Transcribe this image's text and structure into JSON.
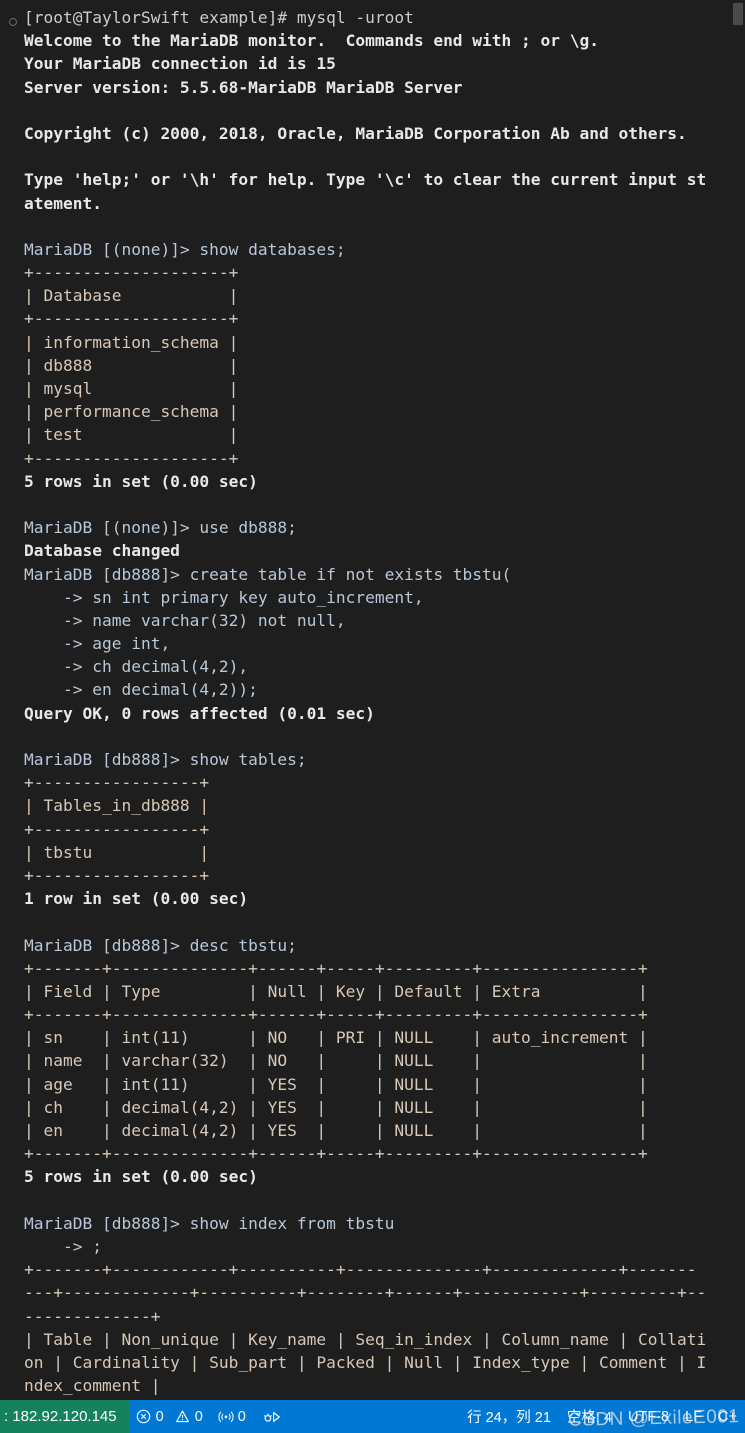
{
  "terminal": {
    "lines": [
      {
        "text": "[root@TaylorSwift example]# mysql -uroot",
        "style": "default",
        "marker": true
      },
      {
        "text": "Welcome to the MariaDB monitor.  Commands end with ; or \\g.",
        "style": "bold"
      },
      {
        "text": "Your MariaDB connection id is 15",
        "style": "bold"
      },
      {
        "text": "Server version: 5.5.68-MariaDB MariaDB Server",
        "style": "bold"
      },
      {
        "text": "",
        "style": "default"
      },
      {
        "text": "Copyright (c) 2000, 2018, Oracle, MariaDB Corporation Ab and others.",
        "style": "bold"
      },
      {
        "text": "",
        "style": "default"
      },
      {
        "text": "Type 'help;' or '\\h' for help. Type '\\c' to clear the current input st",
        "style": "bold"
      },
      {
        "text": "atement.",
        "style": "bold"
      },
      {
        "text": "",
        "style": "default"
      },
      {
        "text": "MariaDB [(none)]> show databases;",
        "style": "prompt"
      },
      {
        "text": "+--------------------+",
        "style": "table"
      },
      {
        "text": "| Database           |",
        "style": "table"
      },
      {
        "text": "+--------------------+",
        "style": "table"
      },
      {
        "text": "| information_schema |",
        "style": "table"
      },
      {
        "text": "| db888              |",
        "style": "table"
      },
      {
        "text": "| mysql              |",
        "style": "table"
      },
      {
        "text": "| performance_schema |",
        "style": "table"
      },
      {
        "text": "| test               |",
        "style": "table"
      },
      {
        "text": "+--------------------+",
        "style": "table"
      },
      {
        "text": "5 rows in set (0.00 sec)",
        "style": "bold"
      },
      {
        "text": "",
        "style": "default"
      },
      {
        "text": "MariaDB [(none)]> use db888;",
        "style": "prompt"
      },
      {
        "text": "Database changed",
        "style": "bold"
      },
      {
        "text": "MariaDB [db888]> create table if not exists tbstu(",
        "style": "prompt"
      },
      {
        "text": "    -> sn int primary key auto_increment,",
        "style": "prompt"
      },
      {
        "text": "    -> name varchar(32) not null,",
        "style": "prompt"
      },
      {
        "text": "    -> age int,",
        "style": "prompt"
      },
      {
        "text": "    -> ch decimal(4,2),",
        "style": "prompt"
      },
      {
        "text": "    -> en decimal(4,2));",
        "style": "prompt"
      },
      {
        "text": "Query OK, 0 rows affected (0.01 sec)",
        "style": "bold"
      },
      {
        "text": "",
        "style": "default"
      },
      {
        "text": "MariaDB [db888]> show tables;",
        "style": "prompt"
      },
      {
        "text": "+-----------------+",
        "style": "table"
      },
      {
        "text": "| Tables_in_db888 |",
        "style": "table"
      },
      {
        "text": "+-----------------+",
        "style": "table"
      },
      {
        "text": "| tbstu           |",
        "style": "table"
      },
      {
        "text": "+-----------------+",
        "style": "table"
      },
      {
        "text": "1 row in set (0.00 sec)",
        "style": "bold"
      },
      {
        "text": "",
        "style": "default"
      },
      {
        "text": "MariaDB [db888]> desc tbstu;",
        "style": "prompt"
      },
      {
        "text": "+-------+--------------+------+-----+---------+----------------+",
        "style": "table"
      },
      {
        "text": "| Field | Type         | Null | Key | Default | Extra          |",
        "style": "table"
      },
      {
        "text": "+-------+--------------+------+-----+---------+----------------+",
        "style": "table"
      },
      {
        "text": "| sn    | int(11)      | NO   | PRI | NULL    | auto_increment |",
        "style": "table"
      },
      {
        "text": "| name  | varchar(32)  | NO   |     | NULL    |                |",
        "style": "table"
      },
      {
        "text": "| age   | int(11)      | YES  |     | NULL    |                |",
        "style": "table"
      },
      {
        "text": "| ch    | decimal(4,2) | YES  |     | NULL    |                |",
        "style": "table"
      },
      {
        "text": "| en    | decimal(4,2) | YES  |     | NULL    |                |",
        "style": "table"
      },
      {
        "text": "+-------+--------------+------+-----+---------+----------------+",
        "style": "table"
      },
      {
        "text": "5 rows in set (0.00 sec)",
        "style": "bold"
      },
      {
        "text": "",
        "style": "default"
      },
      {
        "text": "MariaDB [db888]> show index from tbstu",
        "style": "prompt"
      },
      {
        "text": "    -> ;",
        "style": "prompt"
      },
      {
        "text": "+-------+------------+----------+--------------+-------------+-------",
        "style": "table"
      },
      {
        "text": "---+-------------+----------+--------+------+------------+---------+--",
        "style": "table"
      },
      {
        "text": "-------------+",
        "style": "table"
      },
      {
        "text": "| Table | Non_unique | Key_name | Seq_in_index | Column_name | Collati",
        "style": "table"
      },
      {
        "text": "on | Cardinality | Sub_part | Packed | Null | Index_type | Comment | I",
        "style": "table"
      },
      {
        "text": "ndex_comment |",
        "style": "table"
      },
      {
        "text": "+-------+------------+----------+--------------+-------------+-------",
        "style": "table"
      }
    ]
  },
  "statusbar": {
    "remote_label": ": 182.92.120.145",
    "errors_count": "0",
    "warnings_count": "0",
    "ports_count": "0",
    "cursor_position": "行 24，列 21",
    "indentation": "空格: 4",
    "encoding": "UTF-8",
    "end_of_line": "LF",
    "language_mode": "C+",
    "colors": {
      "remote_background": "#16825D",
      "statusbar_background": "#0078D4",
      "terminal_background": "#1E1E1E",
      "terminal_foreground": "#CCCCCC"
    }
  },
  "watermark": {
    "text": "CSDN @ExileE001"
  }
}
